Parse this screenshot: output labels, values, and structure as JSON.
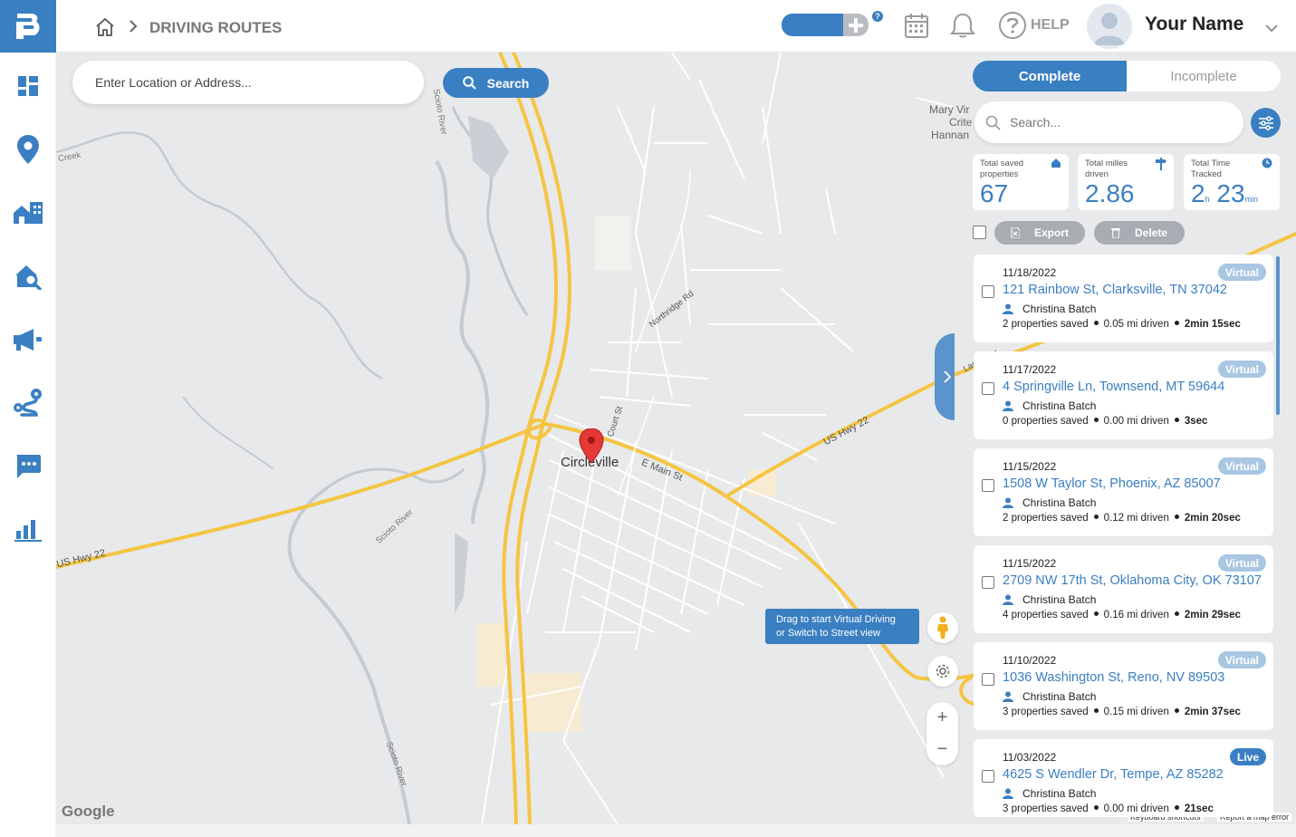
{
  "header": {
    "breadcrumb_title": "DRIVING ROUTES",
    "help_label": "HELP",
    "user_name": "Your Name",
    "toggle_help_badge": "?"
  },
  "search": {
    "location_placeholder": "Enter Location or Address...",
    "button_label": "Search"
  },
  "panel": {
    "tabs": [
      "Complete",
      "Incomplete"
    ],
    "search_placeholder": "Search...",
    "stats": [
      {
        "label": "Total saved properties",
        "value": "67"
      },
      {
        "label": "Total milles driven",
        "value": "2.86"
      },
      {
        "label": "Total Time Tracked",
        "value_h": "2",
        "unit_h": "h",
        "value_m": "23",
        "unit_m": "min"
      }
    ],
    "export_label": "Export",
    "delete_label": "Delete",
    "routes": [
      {
        "date": "11/18/2022",
        "address": "121 Rainbow St, Clarksville, TN 37042",
        "user": "Christina Batch",
        "properties": "2 properties saved",
        "miles": "0.05 mi driven",
        "time": "2min 15sec",
        "badge": "Virtual"
      },
      {
        "date": "11/17/2022",
        "address": "4 Springville Ln, Townsend, MT 59644",
        "user": "Christina Batch",
        "properties": "0 properties saved",
        "miles": "0.00 mi driven",
        "time": "3sec",
        "badge": "Virtual"
      },
      {
        "date": "11/15/2022",
        "address": "1508 W Taylor St, Phoenix, AZ 85007",
        "user": "Christina Batch",
        "properties": "2 properties saved",
        "miles": "0.12 mi driven",
        "time": "2min 20sec",
        "badge": "Virtual"
      },
      {
        "date": "11/15/2022",
        "address": "2709 NW 17th St, Oklahoma City, OK 73107",
        "user": "Christina Batch",
        "properties": "4 properties saved",
        "miles": "0.16 mi driven",
        "time": "2min 29sec",
        "badge": "Virtual"
      },
      {
        "date": "11/10/2022",
        "address": "1036 Washington St, Reno, NV 89503",
        "user": "Christina Batch",
        "properties": "3 properties saved",
        "miles": "0.15 mi driven",
        "time": "2min 37sec",
        "badge": "Virtual"
      },
      {
        "date": "11/03/2022",
        "address": "4625 S Wendler Dr, Tempe, AZ 85282",
        "user": "Christina Batch",
        "properties": "3 properties saved",
        "miles": "0.00 mi driven",
        "time": "21sec",
        "badge": "Live"
      }
    ]
  },
  "map": {
    "city_label": "Circleville",
    "road_labels": [
      "US Hwy 22",
      "US Hwy 22",
      "E Main St",
      "Court St",
      "Northridge Rd",
      "Scioto River",
      "Scioto River",
      "Scioto River",
      "Lancaster"
    ],
    "place_labels": [
      "Mary Vir",
      "Crite",
      "Hannan",
      "Creek"
    ],
    "tooltip_line1": "Drag to start Virtual Driving",
    "tooltip_line2": "or Switch to Street view",
    "zoom_in": "+",
    "zoom_out": "−",
    "google_label": "Google",
    "footer_links": [
      "Keyboard shortcuts",
      "Report a map error"
    ]
  },
  "colors": {
    "brand": "#3a7fc1",
    "virtual_badge": "#a9c6e3",
    "live_badge": "#3a7fc1",
    "map_bg": "#e8e9eb",
    "road_major": "#f5c542"
  }
}
